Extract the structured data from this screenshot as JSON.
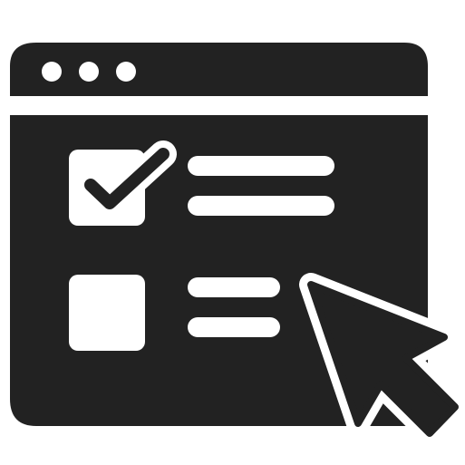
{
  "icon": {
    "name": "browser-checklist-cursor-icon",
    "colors": {
      "foreground": "#222222",
      "background": "#ffffff"
    },
    "window_controls": [
      "dot-icon",
      "dot-icon",
      "dot-icon"
    ],
    "checklist": [
      {
        "checked": true,
        "line_count": 2
      },
      {
        "checked": false,
        "line_count": 2
      }
    ],
    "pointer": "cursor-arrow-icon"
  }
}
